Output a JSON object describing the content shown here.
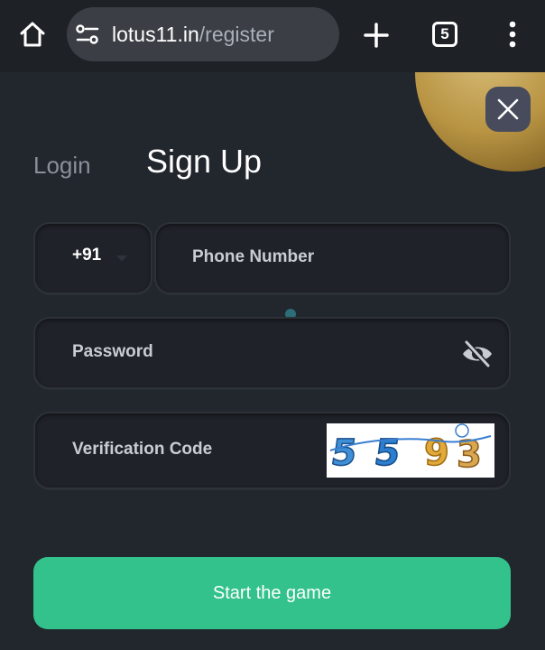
{
  "browser": {
    "url_domain": "lotus11.in",
    "url_path": "/register",
    "tab_count": "5"
  },
  "auth": {
    "login_tab": "Login",
    "signup_tab": "Sign Up"
  },
  "form": {
    "country_code": "+91",
    "phone_placeholder": "Phone Number",
    "password_placeholder": "Password",
    "verification_placeholder": "Verification Code",
    "captcha_digits": [
      "5",
      "5",
      "9",
      "3"
    ],
    "submit_label": "Start the game"
  },
  "colors": {
    "accent": "#33c28b",
    "background": "#22262d",
    "field": "#1f2228"
  },
  "icons": {
    "home": "home-icon",
    "settings": "site-settings-icon",
    "plus": "plus-icon",
    "menu": "more-vert-icon",
    "close": "close-icon",
    "eye": "eye-off-icon",
    "caret": "chevron-down-icon"
  }
}
